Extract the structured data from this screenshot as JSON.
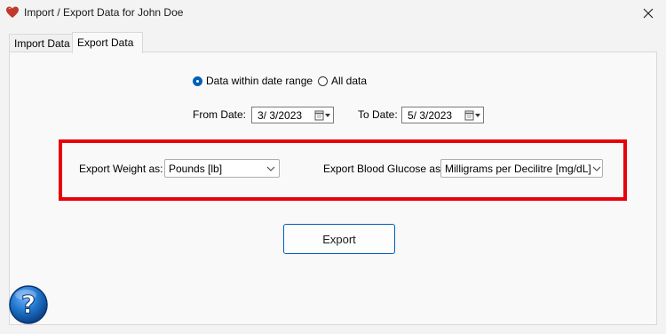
{
  "window": {
    "title": "Import / Export Data for John Doe",
    "app_icon": "heart-icon",
    "close_icon": "close-icon"
  },
  "tabs": [
    {
      "label": "Import Data",
      "active": false
    },
    {
      "label": "Export Data",
      "active": true
    }
  ],
  "range": {
    "option_range": "Data within date range",
    "option_all": "All data",
    "selected": "range"
  },
  "dates": {
    "from_label": "From Date:",
    "from_value": "3/  3/2023",
    "to_label": "To Date:",
    "to_value": "5/  3/2023"
  },
  "units": {
    "weight_label": "Export Weight as:",
    "weight_value": "Pounds [lb]",
    "glucose_label": "Export Blood Glucose as:",
    "glucose_value": "Milligrams per Decilitre [mg/dL]"
  },
  "actions": {
    "export_label": "Export",
    "help_symbol": "?"
  },
  "colors": {
    "accent": "#005fb8",
    "highlight": "#e8000b",
    "help_blue": "#1e74c9"
  }
}
